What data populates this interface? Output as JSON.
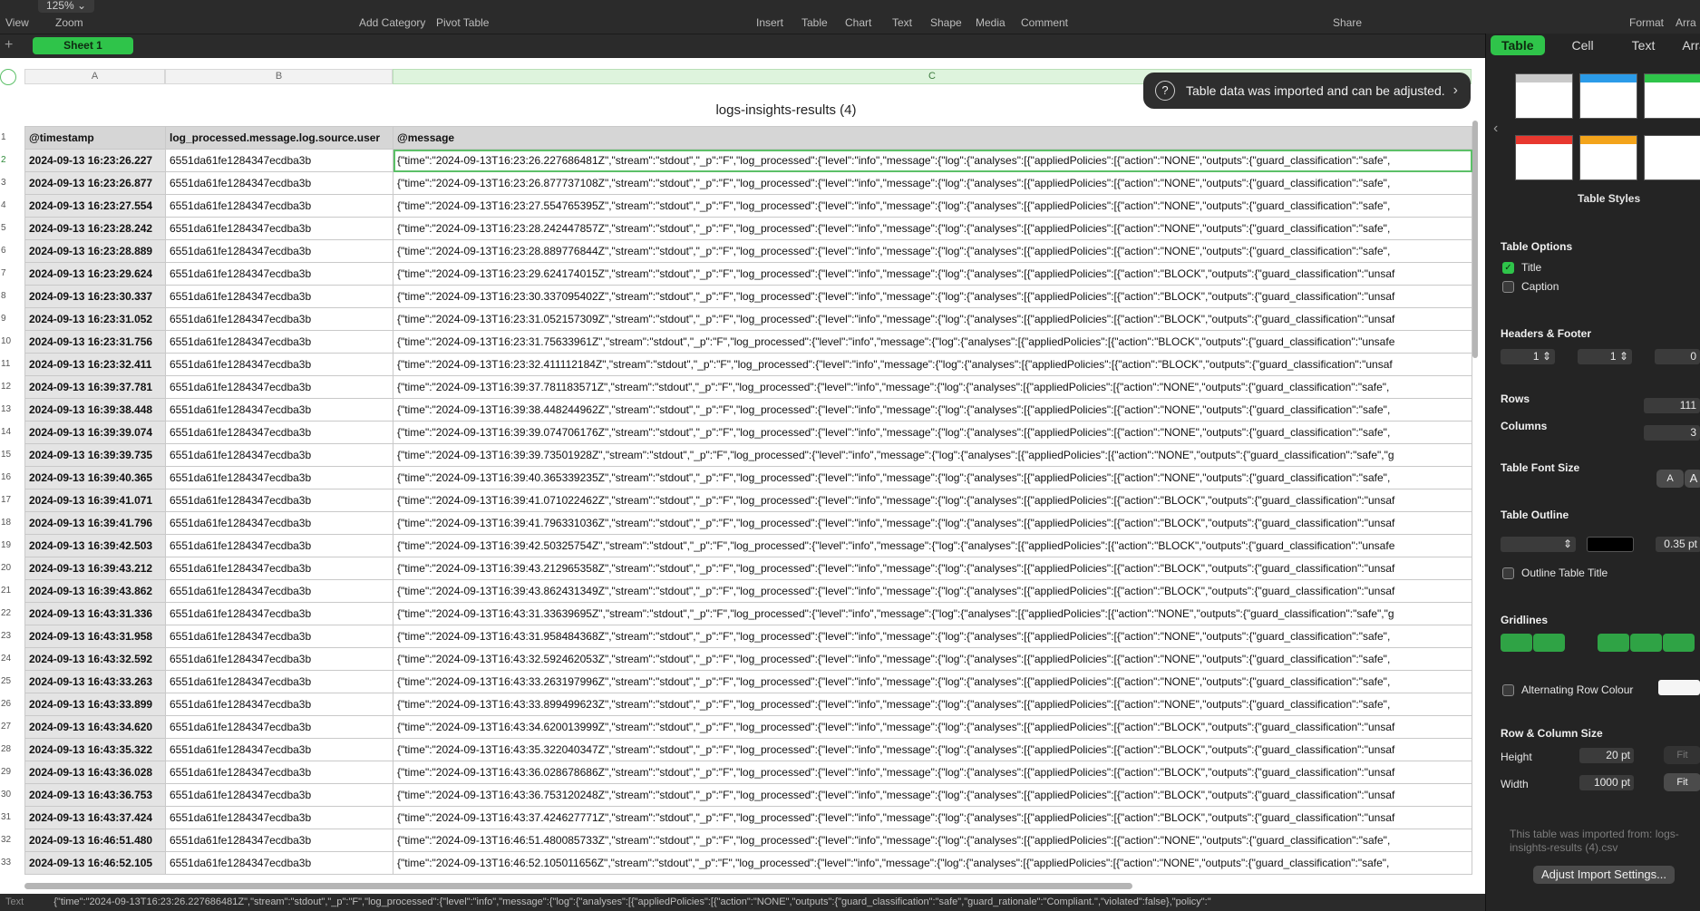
{
  "toolbar": {
    "zoom": "125%",
    "view_label": "View",
    "zoom_label": "Zoom",
    "add_category": "Add Category",
    "pivot_table": "Pivot Table",
    "insert": "Insert",
    "table": "Table",
    "chart": "Chart",
    "text": "Text",
    "shape": "Shape",
    "media": "Media",
    "comment": "Comment",
    "share": "Share",
    "format": "Format",
    "arrange": "Arra"
  },
  "sheet_tab": "Sheet 1",
  "column_headers": [
    "A",
    "B",
    "C"
  ],
  "table_title": "logs-insights-results (4)",
  "header_row": [
    "@timestamp",
    "log_processed.message.log.source.user",
    "@message"
  ],
  "row_numbers": [
    "1",
    "2",
    "3",
    "4",
    "5",
    "6",
    "7",
    "8",
    "9",
    "10",
    "11",
    "12",
    "13",
    "14",
    "15",
    "16",
    "17",
    "18",
    "19",
    "20",
    "21",
    "22",
    "23",
    "24",
    "25",
    "26",
    "27",
    "28",
    "29",
    "30",
    "31",
    "32",
    "33"
  ],
  "rows": [
    [
      "2024-09-13 16:23:26.227",
      "6551da61fe1284347ecdba3b",
      "{\"time\":\"2024-09-13T16:23:26.227686481Z\",\"stream\":\"stdout\",\"_p\":\"F\",\"log_processed\":{\"level\":\"info\",\"message\":{\"log\":{\"analyses\":[{\"appliedPolicies\":[{\"action\":\"NONE\",\"outputs\":{\"guard_classification\":\"safe\","
    ],
    [
      "2024-09-13 16:23:26.877",
      "6551da61fe1284347ecdba3b",
      "{\"time\":\"2024-09-13T16:23:26.877737108Z\",\"stream\":\"stdout\",\"_p\":\"F\",\"log_processed\":{\"level\":\"info\",\"message\":{\"log\":{\"analyses\":[{\"appliedPolicies\":[{\"action\":\"NONE\",\"outputs\":{\"guard_classification\":\"safe\","
    ],
    [
      "2024-09-13 16:23:27.554",
      "6551da61fe1284347ecdba3b",
      "{\"time\":\"2024-09-13T16:23:27.554765395Z\",\"stream\":\"stdout\",\"_p\":\"F\",\"log_processed\":{\"level\":\"info\",\"message\":{\"log\":{\"analyses\":[{\"appliedPolicies\":[{\"action\":\"NONE\",\"outputs\":{\"guard_classification\":\"safe\","
    ],
    [
      "2024-09-13 16:23:28.242",
      "6551da61fe1284347ecdba3b",
      "{\"time\":\"2024-09-13T16:23:28.242447857Z\",\"stream\":\"stdout\",\"_p\":\"F\",\"log_processed\":{\"level\":\"info\",\"message\":{\"log\":{\"analyses\":[{\"appliedPolicies\":[{\"action\":\"NONE\",\"outputs\":{\"guard_classification\":\"safe\","
    ],
    [
      "2024-09-13 16:23:28.889",
      "6551da61fe1284347ecdba3b",
      "{\"time\":\"2024-09-13T16:23:28.889776844Z\",\"stream\":\"stdout\",\"_p\":\"F\",\"log_processed\":{\"level\":\"info\",\"message\":{\"log\":{\"analyses\":[{\"appliedPolicies\":[{\"action\":\"NONE\",\"outputs\":{\"guard_classification\":\"safe\","
    ],
    [
      "2024-09-13 16:23:29.624",
      "6551da61fe1284347ecdba3b",
      "{\"time\":\"2024-09-13T16:23:29.624174015Z\",\"stream\":\"stdout\",\"_p\":\"F\",\"log_processed\":{\"level\":\"info\",\"message\":{\"log\":{\"analyses\":[{\"appliedPolicies\":[{\"action\":\"BLOCK\",\"outputs\":{\"guard_classification\":\"unsaf"
    ],
    [
      "2024-09-13 16:23:30.337",
      "6551da61fe1284347ecdba3b",
      "{\"time\":\"2024-09-13T16:23:30.337095402Z\",\"stream\":\"stdout\",\"_p\":\"F\",\"log_processed\":{\"level\":\"info\",\"message\":{\"log\":{\"analyses\":[{\"appliedPolicies\":[{\"action\":\"BLOCK\",\"outputs\":{\"guard_classification\":\"unsaf"
    ],
    [
      "2024-09-13 16:23:31.052",
      "6551da61fe1284347ecdba3b",
      "{\"time\":\"2024-09-13T16:23:31.052157309Z\",\"stream\":\"stdout\",\"_p\":\"F\",\"log_processed\":{\"level\":\"info\",\"message\":{\"log\":{\"analyses\":[{\"appliedPolicies\":[{\"action\":\"BLOCK\",\"outputs\":{\"guard_classification\":\"unsaf"
    ],
    [
      "2024-09-13 16:23:31.756",
      "6551da61fe1284347ecdba3b",
      "{\"time\":\"2024-09-13T16:23:31.75633961Z\",\"stream\":\"stdout\",\"_p\":\"F\",\"log_processed\":{\"level\":\"info\",\"message\":{\"log\":{\"analyses\":[{\"appliedPolicies\":[{\"action\":\"BLOCK\",\"outputs\":{\"guard_classification\":\"unsafe"
    ],
    [
      "2024-09-13 16:23:32.411",
      "6551da61fe1284347ecdba3b",
      "{\"time\":\"2024-09-13T16:23:32.411112184Z\",\"stream\":\"stdout\",\"_p\":\"F\",\"log_processed\":{\"level\":\"info\",\"message\":{\"log\":{\"analyses\":[{\"appliedPolicies\":[{\"action\":\"BLOCK\",\"outputs\":{\"guard_classification\":\"unsaf"
    ],
    [
      "2024-09-13 16:39:37.781",
      "6551da61fe1284347ecdba3b",
      "{\"time\":\"2024-09-13T16:39:37.781183571Z\",\"stream\":\"stdout\",\"_p\":\"F\",\"log_processed\":{\"level\":\"info\",\"message\":{\"log\":{\"analyses\":[{\"appliedPolicies\":[{\"action\":\"NONE\",\"outputs\":{\"guard_classification\":\"safe\","
    ],
    [
      "2024-09-13 16:39:38.448",
      "6551da61fe1284347ecdba3b",
      "{\"time\":\"2024-09-13T16:39:38.448244962Z\",\"stream\":\"stdout\",\"_p\":\"F\",\"log_processed\":{\"level\":\"info\",\"message\":{\"log\":{\"analyses\":[{\"appliedPolicies\":[{\"action\":\"NONE\",\"outputs\":{\"guard_classification\":\"safe\","
    ],
    [
      "2024-09-13 16:39:39.074",
      "6551da61fe1284347ecdba3b",
      "{\"time\":\"2024-09-13T16:39:39.074706176Z\",\"stream\":\"stdout\",\"_p\":\"F\",\"log_processed\":{\"level\":\"info\",\"message\":{\"log\":{\"analyses\":[{\"appliedPolicies\":[{\"action\":\"NONE\",\"outputs\":{\"guard_classification\":\"safe\","
    ],
    [
      "2024-09-13 16:39:39.735",
      "6551da61fe1284347ecdba3b",
      "{\"time\":\"2024-09-13T16:39:39.73501928Z\",\"stream\":\"stdout\",\"_p\":\"F\",\"log_processed\":{\"level\":\"info\",\"message\":{\"log\":{\"analyses\":[{\"appliedPolicies\":[{\"action\":\"NONE\",\"outputs\":{\"guard_classification\":\"safe\",\"g"
    ],
    [
      "2024-09-13 16:39:40.365",
      "6551da61fe1284347ecdba3b",
      "{\"time\":\"2024-09-13T16:39:40.365339235Z\",\"stream\":\"stdout\",\"_p\":\"F\",\"log_processed\":{\"level\":\"info\",\"message\":{\"log\":{\"analyses\":[{\"appliedPolicies\":[{\"action\":\"NONE\",\"outputs\":{\"guard_classification\":\"safe\","
    ],
    [
      "2024-09-13 16:39:41.071",
      "6551da61fe1284347ecdba3b",
      "{\"time\":\"2024-09-13T16:39:41.071022462Z\",\"stream\":\"stdout\",\"_p\":\"F\",\"log_processed\":{\"level\":\"info\",\"message\":{\"log\":{\"analyses\":[{\"appliedPolicies\":[{\"action\":\"BLOCK\",\"outputs\":{\"guard_classification\":\"unsaf"
    ],
    [
      "2024-09-13 16:39:41.796",
      "6551da61fe1284347ecdba3b",
      "{\"time\":\"2024-09-13T16:39:41.796331036Z\",\"stream\":\"stdout\",\"_p\":\"F\",\"log_processed\":{\"level\":\"info\",\"message\":{\"log\":{\"analyses\":[{\"appliedPolicies\":[{\"action\":\"BLOCK\",\"outputs\":{\"guard_classification\":\"unsaf"
    ],
    [
      "2024-09-13 16:39:42.503",
      "6551da61fe1284347ecdba3b",
      "{\"time\":\"2024-09-13T16:39:42.50325754Z\",\"stream\":\"stdout\",\"_p\":\"F\",\"log_processed\":{\"level\":\"info\",\"message\":{\"log\":{\"analyses\":[{\"appliedPolicies\":[{\"action\":\"BLOCK\",\"outputs\":{\"guard_classification\":\"unsafe"
    ],
    [
      "2024-09-13 16:39:43.212",
      "6551da61fe1284347ecdba3b",
      "{\"time\":\"2024-09-13T16:39:43.212965358Z\",\"stream\":\"stdout\",\"_p\":\"F\",\"log_processed\":{\"level\":\"info\",\"message\":{\"log\":{\"analyses\":[{\"appliedPolicies\":[{\"action\":\"BLOCK\",\"outputs\":{\"guard_classification\":\"unsaf"
    ],
    [
      "2024-09-13 16:39:43.862",
      "6551da61fe1284347ecdba3b",
      "{\"time\":\"2024-09-13T16:39:43.862431349Z\",\"stream\":\"stdout\",\"_p\":\"F\",\"log_processed\":{\"level\":\"info\",\"message\":{\"log\":{\"analyses\":[{\"appliedPolicies\":[{\"action\":\"BLOCK\",\"outputs\":{\"guard_classification\":\"unsaf"
    ],
    [
      "2024-09-13 16:43:31.336",
      "6551da61fe1284347ecdba3b",
      "{\"time\":\"2024-09-13T16:43:31.33639695Z\",\"stream\":\"stdout\",\"_p\":\"F\",\"log_processed\":{\"level\":\"info\",\"message\":{\"log\":{\"analyses\":[{\"appliedPolicies\":[{\"action\":\"NONE\",\"outputs\":{\"guard_classification\":\"safe\",\"g"
    ],
    [
      "2024-09-13 16:43:31.958",
      "6551da61fe1284347ecdba3b",
      "{\"time\":\"2024-09-13T16:43:31.958484368Z\",\"stream\":\"stdout\",\"_p\":\"F\",\"log_processed\":{\"level\":\"info\",\"message\":{\"log\":{\"analyses\":[{\"appliedPolicies\":[{\"action\":\"NONE\",\"outputs\":{\"guard_classification\":\"safe\","
    ],
    [
      "2024-09-13 16:43:32.592",
      "6551da61fe1284347ecdba3b",
      "{\"time\":\"2024-09-13T16:43:32.592462053Z\",\"stream\":\"stdout\",\"_p\":\"F\",\"log_processed\":{\"level\":\"info\",\"message\":{\"log\":{\"analyses\":[{\"appliedPolicies\":[{\"action\":\"NONE\",\"outputs\":{\"guard_classification\":\"safe\","
    ],
    [
      "2024-09-13 16:43:33.263",
      "6551da61fe1284347ecdba3b",
      "{\"time\":\"2024-09-13T16:43:33.263197996Z\",\"stream\":\"stdout\",\"_p\":\"F\",\"log_processed\":{\"level\":\"info\",\"message\":{\"log\":{\"analyses\":[{\"appliedPolicies\":[{\"action\":\"NONE\",\"outputs\":{\"guard_classification\":\"safe\","
    ],
    [
      "2024-09-13 16:43:33.899",
      "6551da61fe1284347ecdba3b",
      "{\"time\":\"2024-09-13T16:43:33.899499623Z\",\"stream\":\"stdout\",\"_p\":\"F\",\"log_processed\":{\"level\":\"info\",\"message\":{\"log\":{\"analyses\":[{\"appliedPolicies\":[{\"action\":\"NONE\",\"outputs\":{\"guard_classification\":\"safe\","
    ],
    [
      "2024-09-13 16:43:34.620",
      "6551da61fe1284347ecdba3b",
      "{\"time\":\"2024-09-13T16:43:34.620013999Z\",\"stream\":\"stdout\",\"_p\":\"F\",\"log_processed\":{\"level\":\"info\",\"message\":{\"log\":{\"analyses\":[{\"appliedPolicies\":[{\"action\":\"BLOCK\",\"outputs\":{\"guard_classification\":\"unsaf"
    ],
    [
      "2024-09-13 16:43:35.322",
      "6551da61fe1284347ecdba3b",
      "{\"time\":\"2024-09-13T16:43:35.322040347Z\",\"stream\":\"stdout\",\"_p\":\"F\",\"log_processed\":{\"level\":\"info\",\"message\":{\"log\":{\"analyses\":[{\"appliedPolicies\":[{\"action\":\"BLOCK\",\"outputs\":{\"guard_classification\":\"unsaf"
    ],
    [
      "2024-09-13 16:43:36.028",
      "6551da61fe1284347ecdba3b",
      "{\"time\":\"2024-09-13T16:43:36.028678686Z\",\"stream\":\"stdout\",\"_p\":\"F\",\"log_processed\":{\"level\":\"info\",\"message\":{\"log\":{\"analyses\":[{\"appliedPolicies\":[{\"action\":\"BLOCK\",\"outputs\":{\"guard_classification\":\"unsaf"
    ],
    [
      "2024-09-13 16:43:36.753",
      "6551da61fe1284347ecdba3b",
      "{\"time\":\"2024-09-13T16:43:36.753120248Z\",\"stream\":\"stdout\",\"_p\":\"F\",\"log_processed\":{\"level\":\"info\",\"message\":{\"log\":{\"analyses\":[{\"appliedPolicies\":[{\"action\":\"BLOCK\",\"outputs\":{\"guard_classification\":\"unsaf"
    ],
    [
      "2024-09-13 16:43:37.424",
      "6551da61fe1284347ecdba3b",
      "{\"time\":\"2024-09-13T16:43:37.424627771Z\",\"stream\":\"stdout\",\"_p\":\"F\",\"log_processed\":{\"level\":\"info\",\"message\":{\"log\":{\"analyses\":[{\"appliedPolicies\":[{\"action\":\"BLOCK\",\"outputs\":{\"guard_classification\":\"unsaf"
    ],
    [
      "2024-09-13 16:46:51.480",
      "6551da61fe1284347ecdba3b",
      "{\"time\":\"2024-09-13T16:46:51.480085733Z\",\"stream\":\"stdout\",\"_p\":\"F\",\"log_processed\":{\"level\":\"info\",\"message\":{\"log\":{\"analyses\":[{\"appliedPolicies\":[{\"action\":\"NONE\",\"outputs\":{\"guard_classification\":\"safe\","
    ],
    [
      "2024-09-13 16:46:52.105",
      "6551da61fe1284347ecdba3b",
      "{\"time\":\"2024-09-13T16:46:52.105011656Z\",\"stream\":\"stdout\",\"_p\":\"F\",\"log_processed\":{\"level\":\"info\",\"message\":{\"log\":{\"analyses\":[{\"appliedPolicies\":[{\"action\":\"NONE\",\"outputs\":{\"guard_classification\":\"safe\","
    ]
  ],
  "toast": "Table data was imported and can be adjusted.",
  "status_text": "Text",
  "status_formula": "{\"time\":\"2024-09-13T16:23:26.227686481Z\",\"stream\":\"stdout\",\"_p\":\"F\",\"log_processed\":{\"level\":\"info\",\"message\":{\"log\":{\"analyses\":[{\"appliedPolicies\":[{\"action\":\"NONE\",\"outputs\":{\"guard_classification\":\"safe\",\"guard_rationale\":\"Compliant.\",\"violated\":false},\"policy\":\"",
  "sidebar": {
    "tabs": [
      "Table",
      "Cell",
      "Text",
      "Arra"
    ],
    "table_styles_label": "Table Styles",
    "table_options_label": "Table Options",
    "title_label": "Title",
    "caption_label": "Caption",
    "headers_footer_label": "Headers & Footer",
    "header_rows": "1",
    "header_cols": "1",
    "footer_rows": "0",
    "rows_label": "Rows",
    "rows_value": "111",
    "columns_label": "Columns",
    "columns_value": "3",
    "font_size_label": "Table Font Size",
    "font_small": "A",
    "font_large": "A",
    "outline_label": "Table Outline",
    "outline_width": "0.35 pt",
    "outline_title_label": "Outline Table Title",
    "gridlines_label": "Gridlines",
    "alt_row_label": "Alternating Row Colour",
    "row_col_size_label": "Row & Column Size",
    "height_label": "Height",
    "height_value": "20 pt",
    "width_label": "Width",
    "width_value": "1000 pt",
    "fit_label": "Fit",
    "import_note": "This table was imported from: logs-insights-results (4).csv",
    "adjust_button": "Adjust Import Settings..."
  }
}
